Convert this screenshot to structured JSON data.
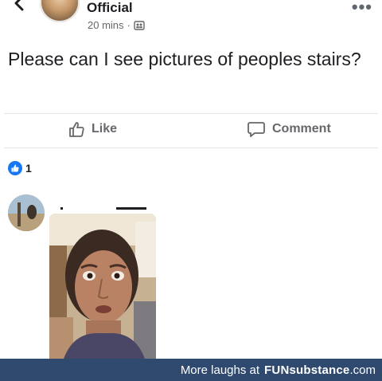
{
  "post": {
    "author": "Official",
    "time": "20 mins",
    "dot": "·",
    "audience_icon": "friends-icon",
    "more": "•••",
    "text": "Please can I see pictures of peoples stairs?"
  },
  "actions": {
    "like_label": "Like",
    "comment_label": "Comment"
  },
  "reactions": {
    "count": "1",
    "type": "like"
  },
  "comment": {
    "content_type": "photo",
    "description_icon": "selfie-photo"
  },
  "footer": {
    "prefix": "More laughs at",
    "brand_bold": "FUN",
    "brand_mid": "substance",
    "brand_suffix": ".com",
    "bg_color": "#2f4a6e"
  },
  "colors": {
    "text": "#1c1e21",
    "muted": "#65676b",
    "like_blue": "#1877f2"
  }
}
